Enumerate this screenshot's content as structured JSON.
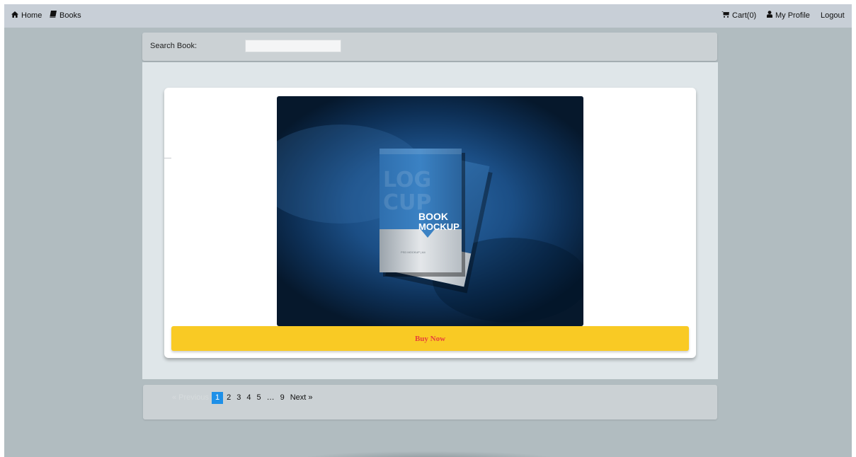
{
  "navbar": {
    "left": [
      {
        "icon": "home-icon",
        "label": "Home"
      },
      {
        "icon": "book-icon",
        "label": "Books"
      }
    ],
    "right": [
      {
        "icon": "cart-icon",
        "label": "Cart(0)"
      },
      {
        "icon": "user-icon",
        "label": "My Profile"
      },
      {
        "label": "Logout"
      }
    ]
  },
  "search": {
    "label": "Search Book:",
    "value": "",
    "placeholder": ""
  },
  "book": {
    "image_title_line1": "BOOK",
    "image_title_line2": "MOCKUP",
    "image_caption": "PSD MOCKUP | A4",
    "buy_label": "Buy Now"
  },
  "pagination": {
    "previous": "« Previous",
    "pages": [
      "1",
      "2",
      "3",
      "4",
      "5"
    ],
    "current": "1",
    "ellipsis": "…",
    "last": "9",
    "next": "Next »"
  },
  "colors": {
    "buy_button": "#f9ca24",
    "buy_text": "#e8413c",
    "active_page": "#1e90e8",
    "navbar": "#c8cfd7",
    "page_bg": "#b1bcc0"
  }
}
